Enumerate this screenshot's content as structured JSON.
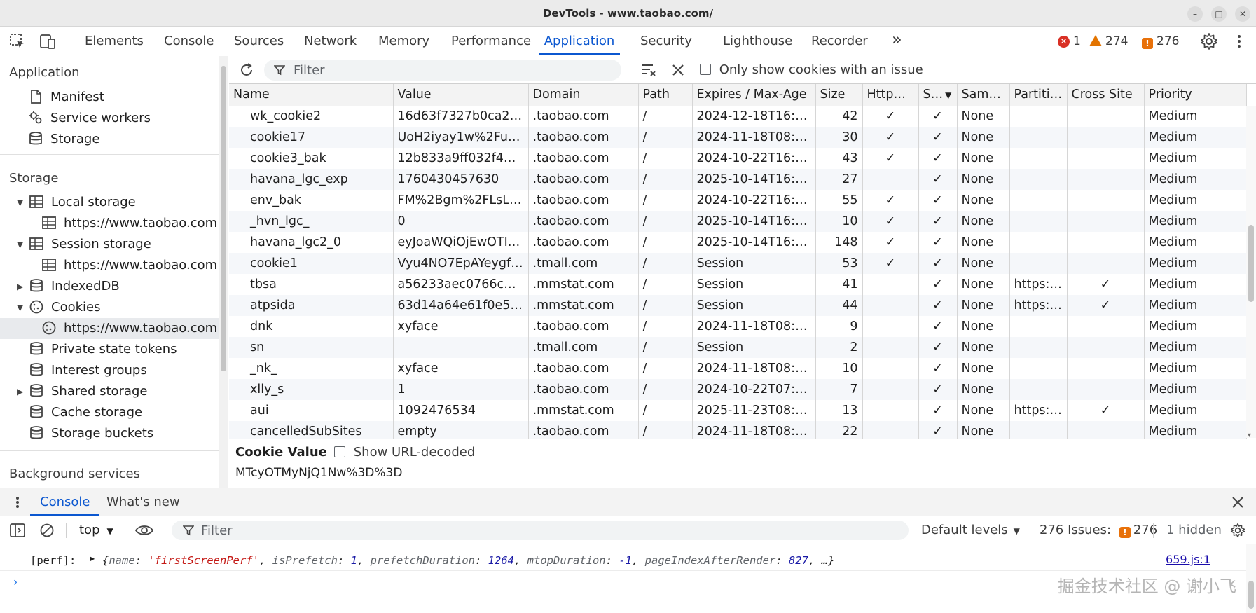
{
  "window": {
    "title": "DevTools - www.taobao.com/"
  },
  "toolbar": {
    "tabs": [
      "Elements",
      "Console",
      "Sources",
      "Network",
      "Memory",
      "Performance",
      "Application",
      "Security",
      "Lighthouse",
      "Recorder"
    ],
    "more_label": "»",
    "errors": "1",
    "warnings": "274",
    "issues": "276"
  },
  "sidebar": {
    "application_header": "Application",
    "app_items": [
      "Manifest",
      "Service workers",
      "Storage"
    ],
    "storage_header": "Storage",
    "local_storage": "Local storage",
    "local_storage_origin": "https://www.taobao.com",
    "session_storage": "Session storage",
    "session_storage_origin": "https://www.taobao.com",
    "indexeddb": "IndexedDB",
    "cookies": "Cookies",
    "cookies_origin": "https://www.taobao.com",
    "private_state_tokens": "Private state tokens",
    "interest_groups": "Interest groups",
    "shared_storage": "Shared storage",
    "cache_storage": "Cache storage",
    "storage_buckets": "Storage buckets",
    "background_header": "Background services"
  },
  "cookies_toolbar": {
    "filter_placeholder": "Filter",
    "only_issue_label": "Only show cookies with an issue"
  },
  "table": {
    "columns": [
      "Name",
      "Value",
      "Domain",
      "Path",
      "Expires / Max-Age",
      "Size",
      "Http…",
      "S…",
      "Sam…",
      "Partiti…",
      "Cross Site",
      "Priority"
    ],
    "rows": [
      [
        "wk_cookie2",
        "16d63f7327b0ca26…",
        ".taobao.com",
        "/",
        "2024-12-18T16:2…",
        "42",
        "✓",
        "✓",
        "None",
        "",
        "",
        "Medium"
      ],
      [
        "cookie17",
        "UoH2iyay1w%2FuX…",
        ".taobao.com",
        "/",
        "2024-11-18T08:2…",
        "30",
        "✓",
        "✓",
        "None",
        "",
        "",
        "Medium"
      ],
      [
        "cookie3_bak",
        "12b833a9ff032f48f…",
        ".taobao.com",
        "/",
        "2024-10-22T16:2…",
        "43",
        "✓",
        "✓",
        "None",
        "",
        "",
        "Medium"
      ],
      [
        "havana_lgc_exp",
        "1760430457630",
        ".taobao.com",
        "/",
        "2025-10-14T16:2…",
        "27",
        "",
        "✓",
        "None",
        "",
        "",
        "Medium"
      ],
      [
        "env_bak",
        "FM%2Bgm%2FLsL0…",
        ".taobao.com",
        "/",
        "2024-10-22T16:2…",
        "55",
        "✓",
        "✓",
        "None",
        "",
        "",
        "Medium"
      ],
      [
        "_hvn_lgc_",
        "0",
        ".taobao.com",
        "/",
        "2025-10-14T16:2…",
        "10",
        "✓",
        "✓",
        "None",
        "",
        "",
        "Medium"
      ],
      [
        "havana_lgc2_0",
        "eyJoaWQiOjEwOTI…",
        ".taobao.com",
        "/",
        "2025-10-14T16:2…",
        "148",
        "✓",
        "✓",
        "None",
        "",
        "",
        "Medium"
      ],
      [
        "cookie1",
        "Vyu4NO7EpAYeygf…",
        ".tmall.com",
        "/",
        "Session",
        "53",
        "✓",
        "✓",
        "None",
        "",
        "",
        "Medium"
      ],
      [
        "tbsa",
        "a56233aec0766c99…",
        ".mmstat.com",
        "/",
        "Session",
        "41",
        "",
        "✓",
        "None",
        "https:…",
        "✓",
        "Medium"
      ],
      [
        "atpsida",
        "63d14a64e61f0e5c…",
        ".mmstat.com",
        "/",
        "Session",
        "44",
        "",
        "✓",
        "None",
        "https:…",
        "✓",
        "Medium"
      ],
      [
        "dnk",
        "xyface",
        ".taobao.com",
        "/",
        "2024-11-18T08:2…",
        "9",
        "",
        "✓",
        "None",
        "",
        "",
        "Medium"
      ],
      [
        "sn",
        "",
        ".tmall.com",
        "/",
        "Session",
        "2",
        "",
        "✓",
        "None",
        "",
        "",
        "Medium"
      ],
      [
        "_nk_",
        "xyface",
        ".taobao.com",
        "/",
        "2024-11-18T08:2…",
        "10",
        "",
        "✓",
        "None",
        "",
        "",
        "Medium"
      ],
      [
        "xlly_s",
        "1",
        ".taobao.com",
        "/",
        "2024-10-22T07:5…",
        "7",
        "",
        "✓",
        "None",
        "",
        "",
        "Medium"
      ],
      [
        "aui",
        "1092476534",
        ".mmstat.com",
        "/",
        "2025-11-23T08:2…",
        "13",
        "",
        "✓",
        "None",
        "https:…",
        "✓",
        "Medium"
      ],
      [
        "cancelledSubSites",
        "empty",
        ".taobao.com",
        "/",
        "2024-11-18T08:2…",
        "22",
        "",
        "✓",
        "None",
        "",
        "",
        "Medium"
      ]
    ]
  },
  "cookie_value": {
    "label": "Cookie Value",
    "decode_label": "Show URL-decoded",
    "value": "MTcyOTMyNjQ1Nw%3D%3D"
  },
  "drawer": {
    "tabs": [
      "Console",
      "What's new"
    ],
    "context": "top",
    "filter_placeholder": "Filter",
    "levels": "Default levels",
    "issues_label": "276 Issues:",
    "issues_count": "276",
    "hidden": "1 hidden"
  },
  "console": {
    "prefix": "[perf]:",
    "obj_open": "{",
    "k1": "name",
    "v1": "'firstScreenPerf'",
    "k2": "isPrefetch",
    "v2": "1",
    "k3": "prefetchDuration",
    "v3": "1264",
    "k4": "mtopDuration",
    "v4": "-1",
    "k5": "pageIndexAfterRender",
    "v5": "827",
    "tail": "…}",
    "source": "659.js:1",
    "watermark": "掘金技术社区 @ 谢小飞"
  }
}
